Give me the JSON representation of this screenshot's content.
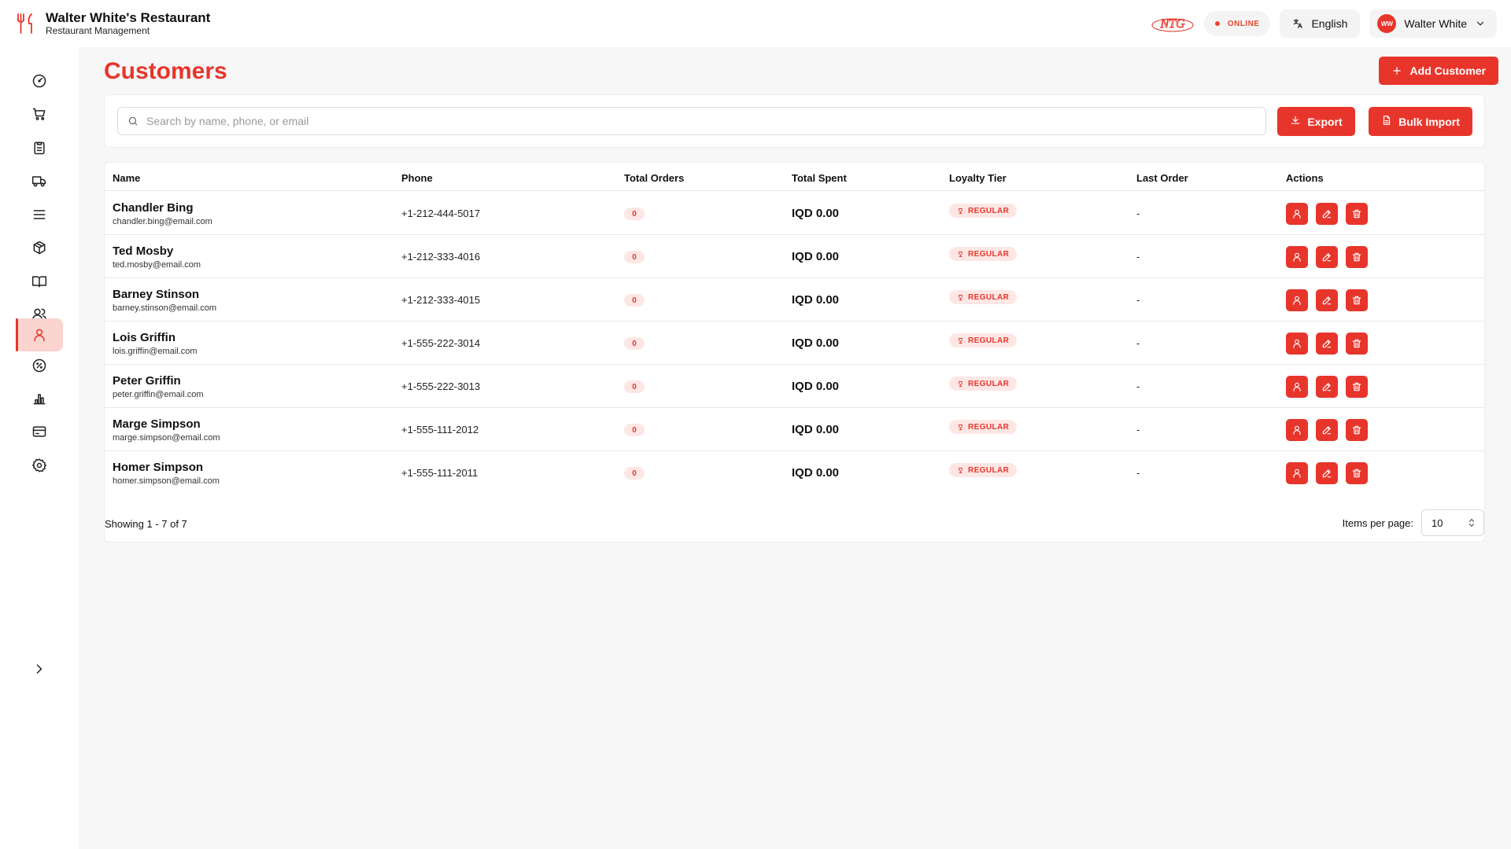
{
  "app": {
    "title": "Walter White's Restaurant",
    "subtitle": "Restaurant Management"
  },
  "header": {
    "status": "ONLINE",
    "language": "English",
    "user_name": "Walter White",
    "user_initials": "WW",
    "partner_logo": "NTG"
  },
  "sidebar": {
    "items": [
      {
        "name": "dashboard",
        "icon": "gauge-icon"
      },
      {
        "name": "orders",
        "icon": "cart-icon"
      },
      {
        "name": "tasks",
        "icon": "clipboard-icon"
      },
      {
        "name": "delivery",
        "icon": "truck-icon"
      },
      {
        "name": "menu",
        "icon": "list-icon"
      },
      {
        "name": "inventory",
        "icon": "package-icon"
      },
      {
        "name": "recipes",
        "icon": "book-icon"
      },
      {
        "name": "staff",
        "icon": "users-icon"
      },
      {
        "name": "customers",
        "icon": "user-icon",
        "active": true
      },
      {
        "name": "discounts",
        "icon": "percent-icon"
      },
      {
        "name": "reports",
        "icon": "bar-chart-icon"
      },
      {
        "name": "payments",
        "icon": "credit-card-icon"
      },
      {
        "name": "settings",
        "icon": "gear-icon"
      }
    ],
    "expand_icon": "chevron-right-icon"
  },
  "page": {
    "title": "Customers",
    "add_button": "Add Customer",
    "search_placeholder": "Search by name, phone, or email",
    "search_value": "",
    "export_button": "Export",
    "import_button": "Bulk Import"
  },
  "table": {
    "columns": [
      "Name",
      "Phone",
      "Total Orders",
      "Total Spent",
      "Loyalty Tier",
      "Last Order",
      "Actions"
    ],
    "rows": [
      {
        "name": "Chandler Bing",
        "email": "chandler.bing@email.com",
        "phone": "+1-212-444-5017",
        "orders": "0",
        "spent": "IQD 0.00",
        "tier": "REGULAR",
        "last": "-"
      },
      {
        "name": "Ted Mosby",
        "email": "ted.mosby@email.com",
        "phone": "+1-212-333-4016",
        "orders": "0",
        "spent": "IQD 0.00",
        "tier": "REGULAR",
        "last": "-"
      },
      {
        "name": "Barney Stinson",
        "email": "barney.stinson@email.com",
        "phone": "+1-212-333-4015",
        "orders": "0",
        "spent": "IQD 0.00",
        "tier": "REGULAR",
        "last": "-"
      },
      {
        "name": "Lois Griffin",
        "email": "lois.griffin@email.com",
        "phone": "+1-555-222-3014",
        "orders": "0",
        "spent": "IQD 0.00",
        "tier": "REGULAR",
        "last": "-"
      },
      {
        "name": "Peter Griffin",
        "email": "peter.griffin@email.com",
        "phone": "+1-555-222-3013",
        "orders": "0",
        "spent": "IQD 0.00",
        "tier": "REGULAR",
        "last": "-"
      },
      {
        "name": "Marge Simpson",
        "email": "marge.simpson@email.com",
        "phone": "+1-555-111-2012",
        "orders": "0",
        "spent": "IQD 0.00",
        "tier": "REGULAR",
        "last": "-"
      },
      {
        "name": "Homer Simpson",
        "email": "homer.simpson@email.com",
        "phone": "+1-555-111-2011",
        "orders": "0",
        "spent": "IQD 0.00",
        "tier": "REGULAR",
        "last": "-"
      }
    ]
  },
  "pagination": {
    "showing": "Showing 1 - 7 of 7",
    "items_per_page_label": "Items per page:",
    "items_per_page": "10"
  },
  "colors": {
    "accent": "#e8352b",
    "accent_light": "#fde7e5",
    "background": "#f7f7f7"
  }
}
